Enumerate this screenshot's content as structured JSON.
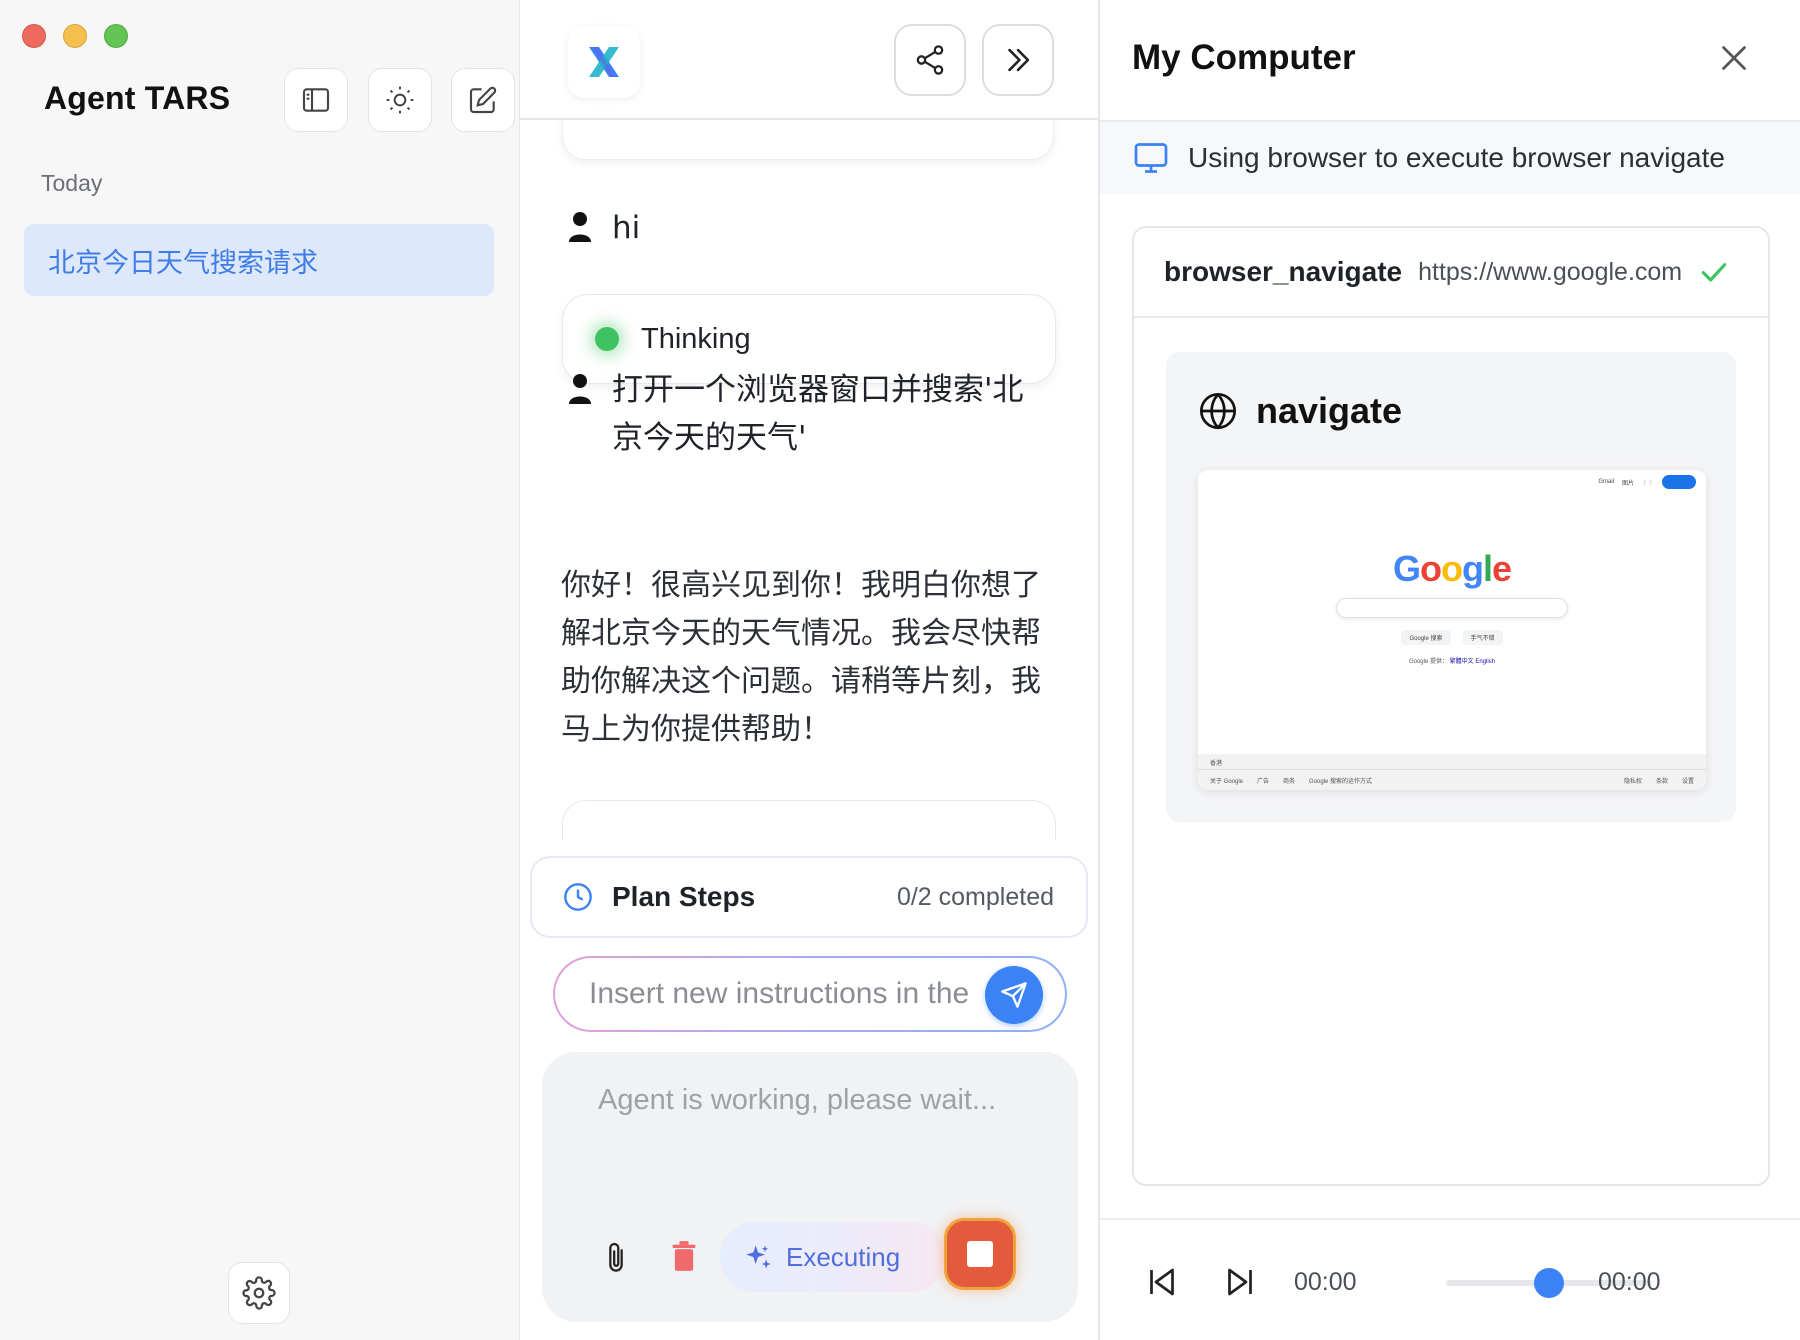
{
  "window": {
    "controls": [
      "close",
      "minimize",
      "maximize"
    ]
  },
  "sidebar": {
    "app_name": "Agent TARS",
    "section_label": "Today",
    "sessions": [
      {
        "title": "北京今日天气搜索请求",
        "active": true
      }
    ],
    "buttons": [
      "panel-layout-icon",
      "sun-icon",
      "edit-icon"
    ],
    "settings_icon": "gear-icon"
  },
  "chat": {
    "header": {
      "logo": "agent-tars-logo",
      "share_icon": "share-icon",
      "collapse_icon": "double-chevron-right-icon"
    },
    "messages": [
      {
        "role": "user",
        "text": "hi"
      },
      {
        "role": "assistant_status",
        "text": "Thinking"
      },
      {
        "role": "user",
        "text": "打开一个浏览器窗口并搜索'北京今天的天气'"
      },
      {
        "role": "assistant",
        "text": "你好！很高兴见到你！我明白你想了解北京今天的天气情况。我会尽快帮助你解决这个问题。请稍等片刻，我马上为你提供帮助！"
      }
    ],
    "plan": {
      "title": "Plan Steps",
      "progress": "0/2 completed"
    },
    "instruction_input": {
      "placeholder": "Insert new instructions in the",
      "value": ""
    },
    "composer": {
      "placeholder": "Agent is working, please wait...",
      "executing_label": "Executing"
    }
  },
  "panel": {
    "title": "My Computer",
    "status": "Using browser to execute browser navigate",
    "tool": {
      "name": "browser_navigate",
      "url": "https://www.google.com",
      "success": true
    },
    "action_title": "navigate",
    "screenshot": {
      "logo": "Google",
      "top_links": [
        "Gmail",
        "图片"
      ],
      "buttons": [
        "Google 搜索",
        "手气不错"
      ],
      "language_prefix": "Google 提供：",
      "language_links": "繁體中文  English",
      "footer_region": "香港",
      "footer_left": [
        "关于 Google",
        "广告",
        "商务",
        "Google 搜索的运作方式"
      ],
      "footer_right": [
        "隐私权",
        "条款",
        "设置"
      ]
    },
    "player": {
      "current_time": "00:00",
      "total_time": "00:00",
      "progress": 0.5
    }
  },
  "colors": {
    "accent": "#3b82f6",
    "session_bg": "#dde9fb",
    "session_text": "#3f7ce8",
    "thinking_dot": "#3fc361",
    "stop_button": "#e45a3c",
    "success": "#3fc361"
  }
}
